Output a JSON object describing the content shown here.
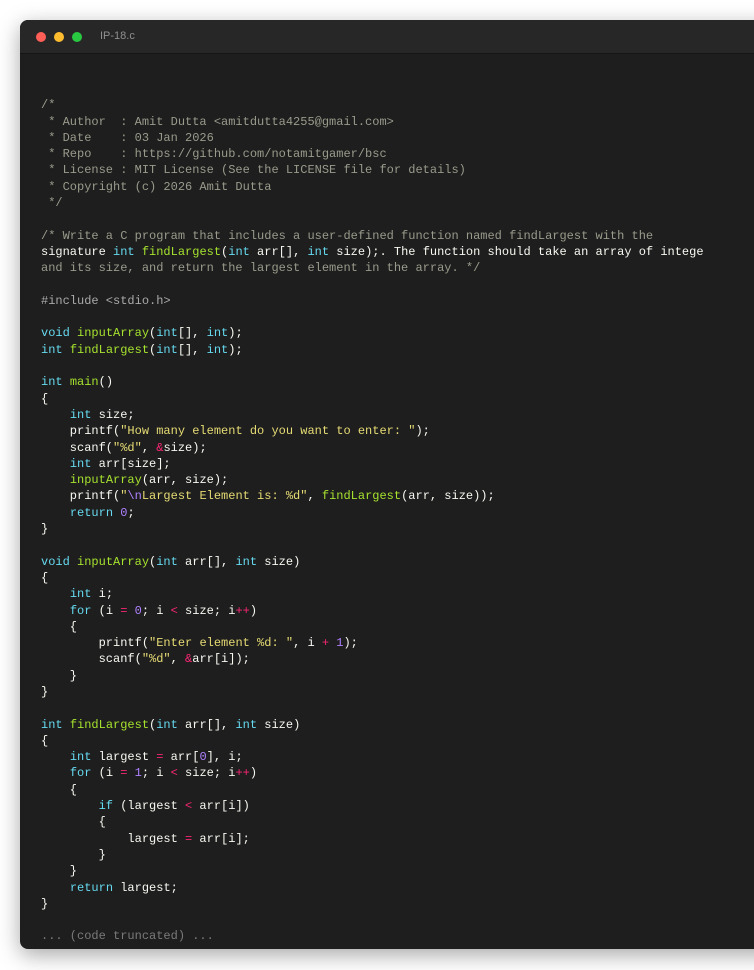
{
  "window": {
    "title": "IP-18.c"
  },
  "code": {
    "lines": [
      "",
      "/*",
      " * Author  : Amit Dutta <amitdutta4255@gmail.com>",
      " * Date    : 03 Jan 2026",
      " * Repo    : https://github.com/notamitgamer/bsc",
      " * License : MIT License (See the LICENSE file for details)",
      " * Copyright (c) 2026 Amit Dutta",
      " */",
      "",
      "/* Write a C program that includes a user-defined function named findLargest with the",
      "signature int findLargest(int arr[], int size);. The function should take an array of intege",
      "and its size, and return the largest element in the array. */",
      "",
      "#include <stdio.h>",
      "",
      "void inputArray(int[], int);",
      "int findLargest(int[], int);",
      "",
      "int main()",
      "{",
      "    int size;",
      "    printf(\"How many element do you want to enter: \");",
      "    scanf(\"%d\", &size);",
      "    int arr[size];",
      "    inputArray(arr, size);",
      "    printf(\"\\nLargest Element is: %d\", findLargest(arr, size));",
      "    return 0;",
      "}",
      "",
      "void inputArray(int arr[], int size)",
      "{",
      "    int i;",
      "    for (i = 0; i < size; i++)",
      "    {",
      "        printf(\"Enter element %d: \", i + 1);",
      "        scanf(\"%d\", &arr[i]);",
      "    }",
      "}",
      "",
      "int findLargest(int arr[], int size)",
      "{",
      "    int largest = arr[0], i;",
      "    for (i = 1; i < size; i++)",
      "    {",
      "        if (largest < arr[i])",
      "        {",
      "            largest = arr[i];",
      "        }",
      "    }",
      "    return largest;",
      "}",
      "",
      "... (code truncated) ..."
    ]
  },
  "colors": {
    "editor_background": "#1e1e1e",
    "titlebar_background": "#272727",
    "comment": "#9a9a8c",
    "keyword": "#66d9ef",
    "function": "#a6e22e",
    "string": "#e6db74",
    "number": "#ae81ff",
    "operator": "#f92672"
  },
  "icons": [
    "close-dot-icon",
    "minimize-dot-icon",
    "zoom-dot-icon"
  ]
}
